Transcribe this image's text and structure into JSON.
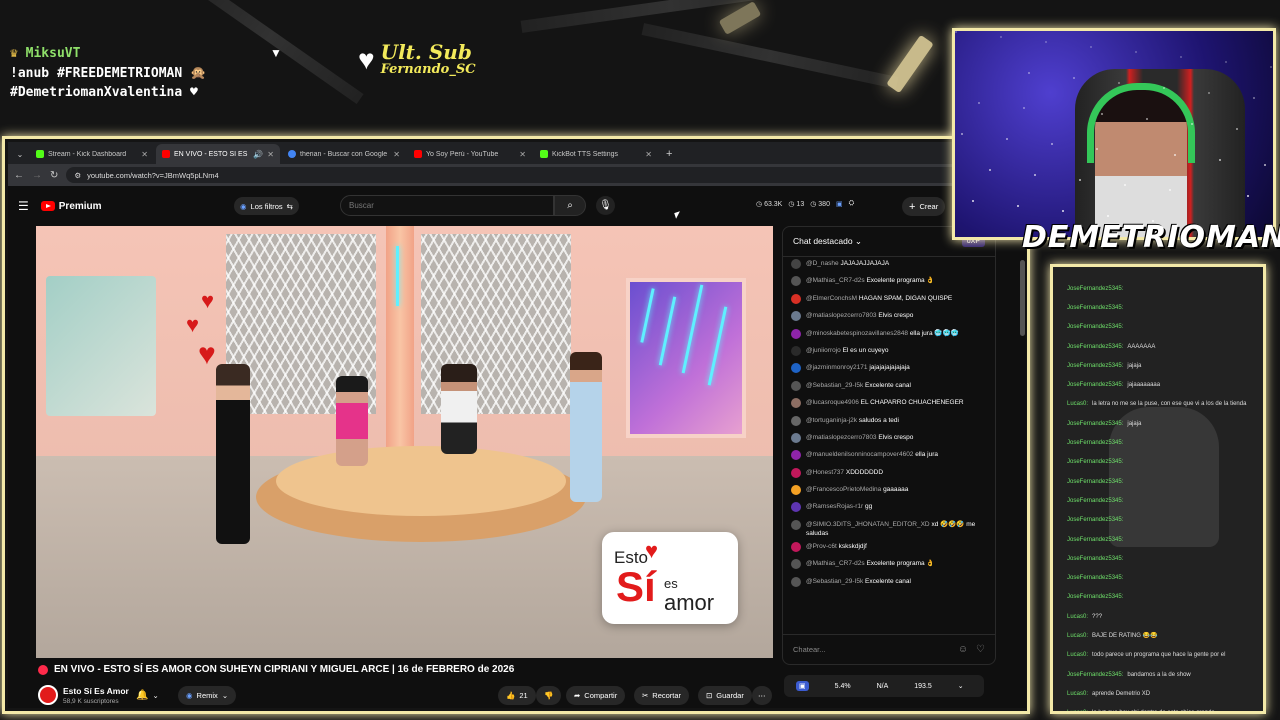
{
  "overlay": {
    "user_name": "MiksuVT",
    "anub_line": "!anub #FREEDEMETRIOMAN",
    "hashtag_line": "#DemetriomanXvalentina",
    "last_sub_title": "Ult. Sub",
    "last_sub_name": "Fernando_SC",
    "streamer_name": "DEMETRIOMAN...",
    "brand_color": "#f3e9a8"
  },
  "browser": {
    "tabs": [
      {
        "label": "Stream - Kick Dashboard",
        "icon": "kick-icon",
        "color": "#53fc18"
      },
      {
        "label": "EN VIVO - ESTO SÍ ES A",
        "icon": "youtube-icon",
        "color": "#ff0000"
      },
      {
        "label": "therian - Buscar con Google",
        "icon": "google-icon",
        "color": "#4285f4"
      },
      {
        "label": "Yo Soy Perú - YouTube",
        "icon": "youtube-icon",
        "color": "#ff0000"
      },
      {
        "label": "KickBot TTS Settings",
        "icon": "kickbot-icon",
        "color": "#53fc18"
      }
    ],
    "new_tab": "+",
    "url": "youtube.com/watch?v=JBmWq5pLNm4"
  },
  "youtube": {
    "logo": "Premium",
    "filters_label": "Los filtros",
    "search_placeholder": "Buscar",
    "stats": {
      "views": "63.3K",
      "likes": "13",
      "comments": "380"
    },
    "create_label": "Crear",
    "video_title": "EN VIVO - ESTO SÍ ES AMOR CON SUHEYN CIPRIANI Y MIGUEL ARCE | 16 de FEBRERO de 2026",
    "channel_name": "Esto Sí Es Amor",
    "channel_subs": "58,9 K suscriptores",
    "remix_label": "Remix",
    "like_count": "21",
    "share_label": "Compartir",
    "clip_label": "Recortar",
    "save_label": "Guardar",
    "logo_card": {
      "esto": "Esto",
      "si": "Sí",
      "es": "es",
      "amor": "amor"
    }
  },
  "chat": {
    "header": "Chat destacado",
    "xp": "0XP",
    "messages": [
      {
        "author": "@D_nashe",
        "text": "JAJAJAJJAJAJA",
        "color": "#444"
      },
      {
        "author": "@Mathias_CR7-d2s",
        "text": "Excelente programa 👌",
        "color": "#555"
      },
      {
        "author": "@ElmerConchsM",
        "text": "HAGAN SPAM, DIGAN QUISPE",
        "color": "#d93025"
      },
      {
        "author": "@matiaslopezcerro7803",
        "text": "Elvis crespo",
        "color": "#6b7a8f"
      },
      {
        "author": "@minoskabetespinozavillanes2848",
        "text": "ella jura 🥶🥶🥶",
        "color": "#8e24aa"
      },
      {
        "author": "@juniiorrojo",
        "text": "El es un cuyeyo",
        "color": "#2a2a2a"
      },
      {
        "author": "@jazminmonroy2171",
        "text": "jajajajajajajaja",
        "color": "#1e63c6"
      },
      {
        "author": "@Sebastian_29-I5k",
        "text": "Excelente canal",
        "color": "#555"
      },
      {
        "author": "@lucasroque4906",
        "text": "EL CHAPARRO CHUACHENEGER",
        "color": "#8d6e63"
      },
      {
        "author": "@tortuganinja-j2k",
        "text": "saludos a tedi",
        "color": "#666"
      },
      {
        "author": "@matiaslopezcerro7803",
        "text": "Elvis crespo",
        "color": "#6b7a8f"
      },
      {
        "author": "@manueldenilsonninocampover4602",
        "text": "ella jura",
        "color": "#8e24aa"
      },
      {
        "author": "@Honest737",
        "text": "XDDDDDDD",
        "color": "#c2185b"
      },
      {
        "author": "@FrancescoPrietoMedina",
        "text": "gaaaaaa",
        "color": "#f4a124"
      },
      {
        "author": "@RamsesRojas-r1r",
        "text": "gg",
        "color": "#5e35b1"
      },
      {
        "author": "@SIMIO.3DITS_JHONATAN_EDITOR_XD",
        "text": "xd 🤣🤣🤣 me saludas",
        "color": "#555"
      },
      {
        "author": "@Prov-c6t",
        "text": "kskskdjdjf",
        "color": "#c2185b"
      },
      {
        "author": "@Mathias_CR7-d2s",
        "text": "Excelente programa 👌",
        "color": "#555"
      },
      {
        "author": "@Sebastian_29-I5k",
        "text": "Excelente canal",
        "color": "#555"
      }
    ],
    "input_placeholder": "Chatear...",
    "extension": {
      "pct": "5.4%",
      "na": "N/A",
      "value": "193.5"
    }
  },
  "overlay_chat": [
    {
      "user": "JoseFernandez5345:",
      "text": ""
    },
    {
      "user": "JoseFernandez5345:",
      "text": ""
    },
    {
      "user": "JoseFernandez5345:",
      "text": ""
    },
    {
      "user": "JoseFernandez5345:",
      "text": "AAAAAAA"
    },
    {
      "user": "JoseFernandez5345:",
      "text": "jajaja"
    },
    {
      "user": "JoseFernandez5345:",
      "text": "jajaaaaaaaa"
    },
    {
      "user": "Lucas0:",
      "text": "la letra no me se la puse, con ese que vi a los de la tienda"
    },
    {
      "user": "JoseFernandez5345:",
      "text": "jajaja"
    },
    {
      "user": "JoseFernandez5345:",
      "text": ""
    },
    {
      "user": "JoseFernandez5345:",
      "text": ""
    },
    {
      "user": "JoseFernandez5345:",
      "text": ""
    },
    {
      "user": "JoseFernandez5345:",
      "text": ""
    },
    {
      "user": "JoseFernandez5345:",
      "text": ""
    },
    {
      "user": "JoseFernandez5345:",
      "text": ""
    },
    {
      "user": "JoseFernandez5345:",
      "text": ""
    },
    {
      "user": "JoseFernandez5345:",
      "text": ""
    },
    {
      "user": "JoseFernandez5345:",
      "text": ""
    },
    {
      "user": "Lucas0:",
      "text": "???"
    },
    {
      "user": "Lucas0:",
      "text": "BAJE DE RATING 😂😂"
    },
    {
      "user": "Lucas0:",
      "text": "todo parece un programa que hace la gente por el"
    },
    {
      "user": "JoseFernandez5345:",
      "text": "bandamos a la de show"
    },
    {
      "user": "Lucas0:",
      "text": "aprende Demetrio XD"
    },
    {
      "user": "Lucas0:",
      "text": "la luz que hay ahi dentro de esta chica grande"
    }
  ]
}
